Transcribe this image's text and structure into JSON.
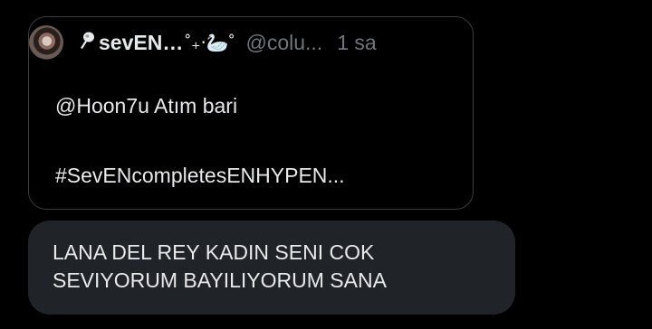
{
  "quoted_tweet": {
    "avatar_alt": "avatar",
    "name_prefix_icon": "dropper-icon",
    "display_name": "sevEN…",
    "name_emoji": "˚₊‧🦢˚",
    "handle": "@colu...",
    "time": "1 sa",
    "mention_line": "@Hoon7u Atım bari",
    "hashtag_line": "#SevENcompletesENHYPEN..."
  },
  "reply_message": {
    "line1": "LANA DEL REY KADIN SENI COK",
    "line2": "SEVIYORUM BAYILIYORUM SANA"
  },
  "colors": {
    "background": "#000000",
    "text_primary": "#e7e9ea",
    "text_secondary": "#71767b",
    "card_border": "#3a3c40",
    "bubble_bg": "#202327"
  }
}
